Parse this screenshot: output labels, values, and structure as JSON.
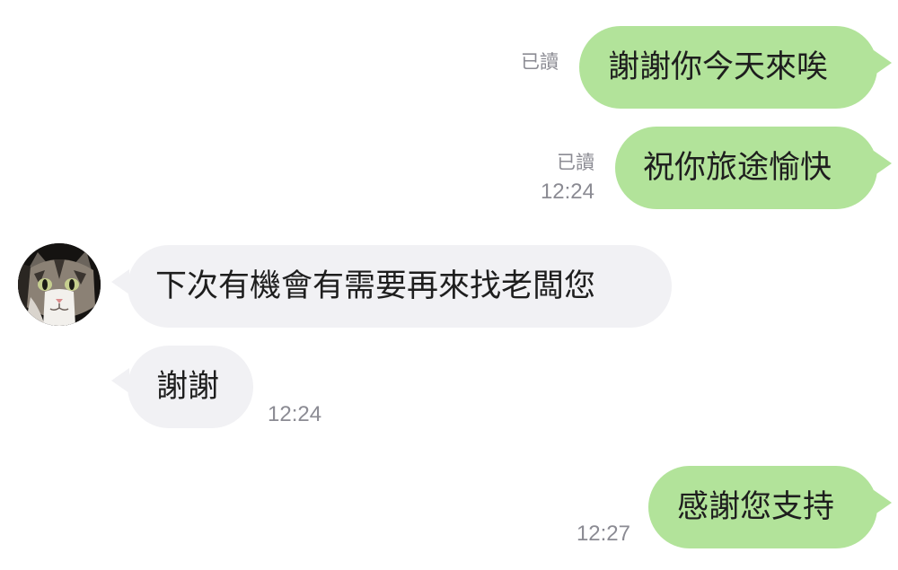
{
  "chat": {
    "messages": [
      {
        "side": "out",
        "text": "謝謝你今天來唉",
        "read": "已讀",
        "time": ""
      },
      {
        "side": "out",
        "text": "祝你旅途愉快",
        "read": "已讀",
        "time": "12:24"
      },
      {
        "side": "in",
        "text": "下次有機會有需要再來找老闆您",
        "time": ""
      },
      {
        "side": "in",
        "text": "謝謝",
        "time": "12:24"
      },
      {
        "side": "out",
        "text": "感謝您支持",
        "read": "",
        "time": "12:27"
      }
    ],
    "avatar_icon": "cat-avatar"
  },
  "colors": {
    "outgoing_bubble": "#b2e39a",
    "incoming_bubble": "#f1f1f4",
    "meta_text": "#8b8b93"
  }
}
